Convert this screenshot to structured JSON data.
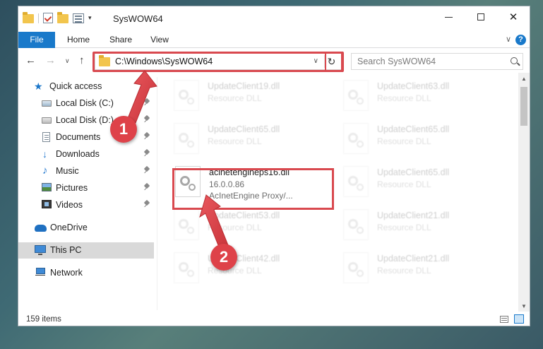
{
  "window": {
    "title": "SysWOW64",
    "controls": {
      "minimize": "—",
      "maximize": "☐",
      "close": "✕"
    }
  },
  "ribbon": {
    "tabs": [
      "File",
      "Home",
      "Share",
      "View"
    ],
    "expand_glyph": "∨",
    "help_glyph": "?"
  },
  "address_bar": {
    "path": "C:\\Windows\\SysWOW64",
    "dropdown_glyph": "∨",
    "refresh_glyph": "↻"
  },
  "search": {
    "placeholder": "Search SysWOW64"
  },
  "nav": {
    "back_glyph": "←",
    "forward_glyph": "→",
    "recent_glyph": "∨",
    "up_glyph": "↑",
    "items": [
      {
        "label": "Quick access",
        "icon": "star-icon",
        "pinned": false
      },
      {
        "label": "Local Disk (C:)",
        "icon": "drive-icon",
        "pinned": true
      },
      {
        "label": "Local Disk (D:)",
        "icon": "drive-icon",
        "pinned": true
      },
      {
        "label": "Documents",
        "icon": "document-icon",
        "pinned": true
      },
      {
        "label": "Downloads",
        "icon": "download-icon",
        "pinned": true
      },
      {
        "label": "Music",
        "icon": "music-icon",
        "pinned": true
      },
      {
        "label": "Pictures",
        "icon": "pictures-icon",
        "pinned": true
      },
      {
        "label": "Videos",
        "icon": "videos-icon",
        "pinned": true
      },
      {
        "label": "OneDrive",
        "icon": "cloud-icon",
        "pinned": false
      },
      {
        "label": "This PC",
        "icon": "pc-icon",
        "pinned": false,
        "selected": true
      },
      {
        "label": "Network",
        "icon": "network-icon",
        "pinned": false
      }
    ]
  },
  "files": [
    {
      "name": "UpdateClient19.dll",
      "desc": "Resource DLL",
      "faded": true
    },
    {
      "name": "UpdateClient63.dll",
      "desc": "Resource DLL",
      "faded": true
    },
    {
      "name": "UpdateClient65.dll",
      "desc": "Resource DLL",
      "faded": true
    },
    {
      "name": "UpdateClient65.dll",
      "desc": "Resource DLL",
      "faded": true
    },
    {
      "name": "acinetengineps16.dll",
      "desc": "16.0.0.86",
      "desc2": "AcInetEngine Proxy/...",
      "faded": false,
      "highlighted": true
    },
    {
      "name": "UpdateClient65.dll",
      "desc": "Resource DLL",
      "faded": true
    },
    {
      "name": "UpdateClient53.dll",
      "desc": "Resource DLL",
      "faded": true
    },
    {
      "name": "UpdateClient21.dll",
      "desc": "Resource DLL",
      "faded": true
    },
    {
      "name": "UpdateClient42.dll",
      "desc": "Resource DLL",
      "faded": true
    },
    {
      "name": "UpdateClient21.dll",
      "desc": "Resource DLL",
      "faded": true
    }
  ],
  "scrollbar": {
    "up_glyph": "▲",
    "down_glyph": "▼"
  },
  "status": {
    "item_count": "159 items"
  },
  "annotations": [
    {
      "number": "1"
    },
    {
      "number": "2"
    }
  ],
  "colors": {
    "accent": "#1979ca",
    "highlight": "#d9494f",
    "marker": "#de4249"
  }
}
